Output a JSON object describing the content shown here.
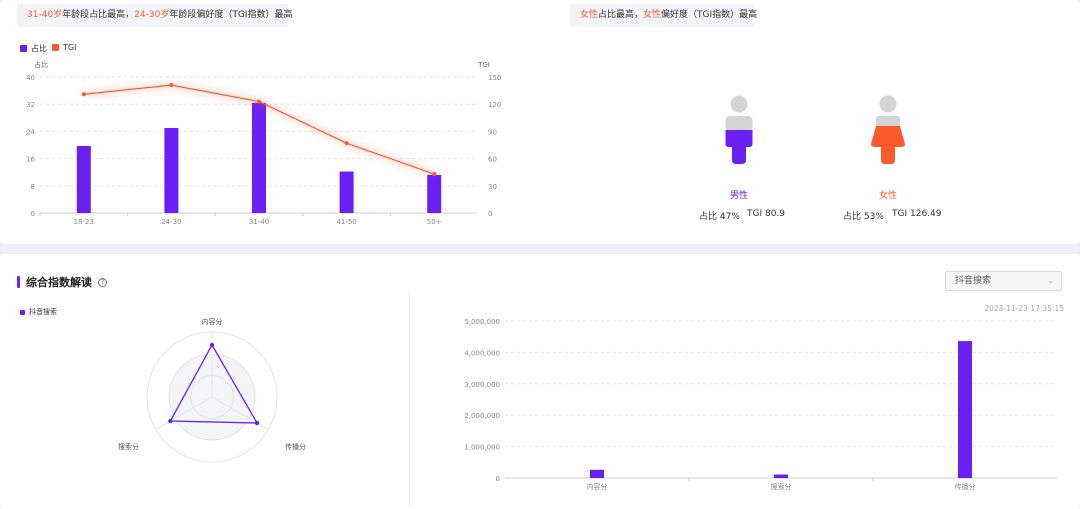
{
  "age_banner": {
    "p1": "31-40岁",
    "p2": "年龄段占比最高，",
    "p3": "24-30岁",
    "p4": "年龄段偏好度（TGI指数）最高"
  },
  "gender_banner": {
    "p1": "女性",
    "p2": "占比最高，",
    "p3": "女性",
    "p4": "偏好度（TGI指数）最高"
  },
  "colors": {
    "purple": "#6a1ff5",
    "orange": "#ff5a2e",
    "grey_head": "#d4d4d4"
  },
  "age_chart": {
    "type": "bar",
    "legend": [
      "占比",
      "TGI"
    ],
    "left_axis_title": "占比",
    "right_axis_title": "TGI",
    "categories": [
      "18-23",
      "24-30",
      "31-40",
      "41-50",
      "50+"
    ],
    "left_ticks": [
      "0",
      "8",
      "16",
      "24",
      "32",
      "40"
    ],
    "right_ticks": [
      "0",
      "30",
      "60",
      "90",
      "120",
      "150"
    ],
    "left_range": [
      0,
      40
    ],
    "right_range": [
      0,
      150
    ],
    "series": [
      {
        "name": "占比",
        "type": "bar",
        "axis": "left",
        "values": [
          19.7,
          25.0,
          32.4,
          12.2,
          11.2
        ]
      },
      {
        "name": "TGI",
        "type": "line",
        "axis": "right",
        "values": [
          131,
          141,
          123,
          77,
          43
        ]
      }
    ]
  },
  "gender": {
    "male": {
      "label": "男性",
      "share_text": "占比 47%",
      "tgi_text": "TGI 80.9",
      "share": 47,
      "tgi": 80.9
    },
    "female": {
      "label": "女性",
      "share_text": "占比 53%",
      "tgi_text": "TGI 126.49",
      "share": 53,
      "tgi": 126.49
    }
  },
  "section": {
    "title": "综合指数解读",
    "help": "?"
  },
  "select": {
    "value": "抖音搜索",
    "chevron": "⌄"
  },
  "timestamp": "2023-11-23 17:35:15",
  "chart_data": [
    {
      "type": "radar",
      "legend": [
        "抖音搜索"
      ],
      "axes": [
        "内容分",
        "传播分",
        "搜索分"
      ],
      "series": [
        {
          "name": "抖音搜索",
          "values": [
            0.8,
            0.8,
            0.74
          ]
        }
      ],
      "max": 1
    },
    {
      "type": "bar",
      "categories": [
        "内容分",
        "搜索分",
        "传播分"
      ],
      "values": [
        260000,
        110000,
        4360000
      ],
      "ylim": [
        0,
        5000000
      ],
      "yticks": [
        "0",
        "1,000,000",
        "2,000,000",
        "3,000,000",
        "4,000,000",
        "5,000,000"
      ],
      "grid": true
    }
  ]
}
